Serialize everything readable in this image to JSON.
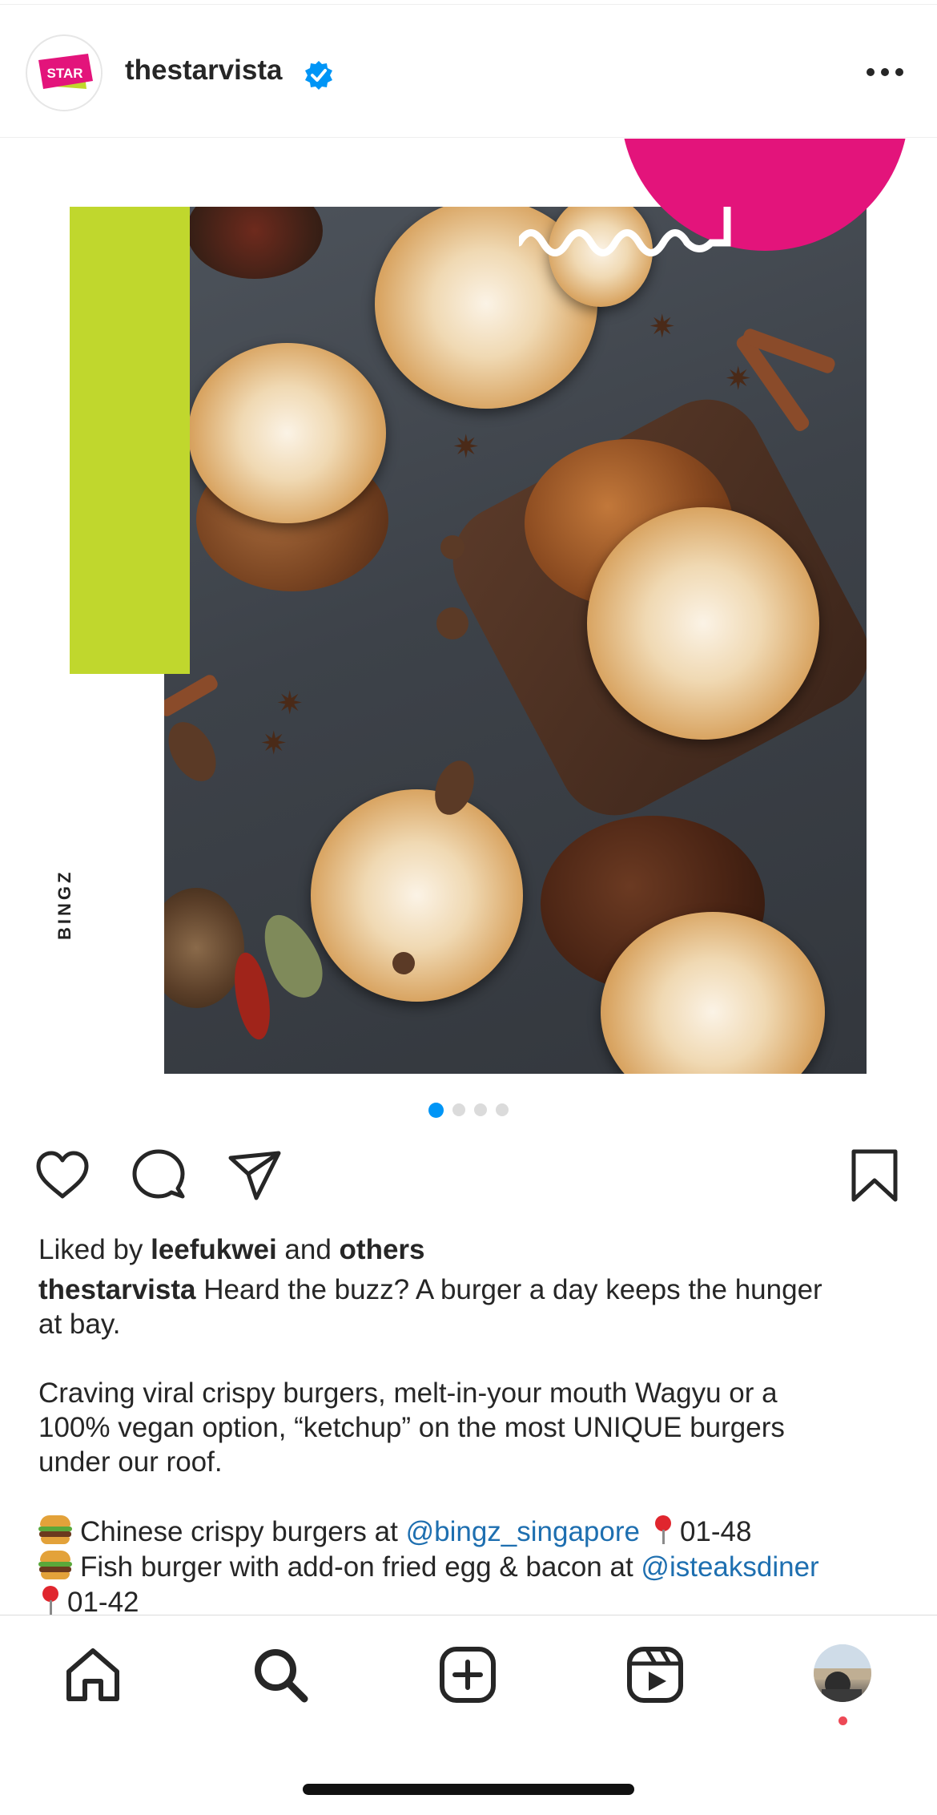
{
  "post": {
    "username": "thestarvista",
    "avatar_logo_text": "STAR",
    "verified": true,
    "image_overlay_text": "BINGZ",
    "carousel": {
      "total": 4,
      "active": 1
    }
  },
  "actions": {
    "like_icon": "heart-icon",
    "comment_icon": "comment-icon",
    "share_icon": "send-icon",
    "save_icon": "bookmark-icon"
  },
  "likes": {
    "prefix": "Liked by ",
    "user": "leefukwei",
    "middle": " and ",
    "others": "others"
  },
  "caption": {
    "username": "thestarvista",
    "line1": " Heard the buzz? A burger a day keeps the hunger",
    "line2": "at bay.",
    "para2_line1": "Craving viral crispy burgers, melt-in-your mouth Wagyu or a",
    "para2_line2": "100% vegan option, “ketchup” on the most UNIQUE burgers",
    "para2_line3": "under our roof.",
    "item1_text": "Chinese crispy burgers at ",
    "item1_mention": "@bingz_singapore",
    "item1_unit": "01-48",
    "item2_text": "Fish burger with add-on fried egg & bacon at ",
    "item2_mention": "@isteaksdiner",
    "item2_unit_partial": "01-42"
  },
  "bottom_nav": {
    "items": [
      "home-icon",
      "search-icon",
      "create-icon",
      "reels-icon",
      "profile-avatar"
    ],
    "notification_dot": true
  },
  "colors": {
    "accent_blue": "#0095f6",
    "mention_blue": "#1e6fb0",
    "brand_pink": "#e3147b",
    "brand_green": "#c0d72d",
    "notification_red": "#ed4956"
  }
}
